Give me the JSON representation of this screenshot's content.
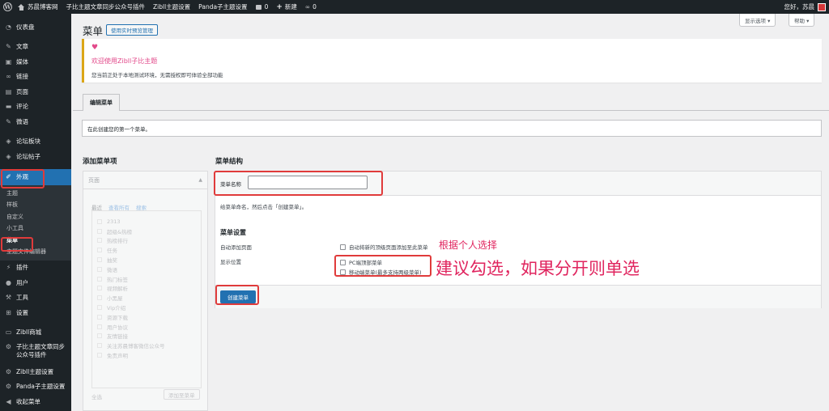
{
  "adminbar": {
    "site_name": "苏晨博客网",
    "items": [
      "子比主题文章同步公众号插件",
      "Zibll主题设置",
      "Panda子主题设置"
    ],
    "comments_count": "0",
    "new_label": "新建",
    "links_count": "0",
    "greeting": "您好，苏晨"
  },
  "screen_options_label": "显示选项 ▾",
  "help_label": "帮助 ▾",
  "sidebar": {
    "top": [
      {
        "icon": "dashboard-icon",
        "label": "仪表盘"
      }
    ],
    "group1": [
      {
        "icon": "pin-icon",
        "label": "文章"
      },
      {
        "icon": "media-icon",
        "label": "媒体"
      },
      {
        "icon": "link-icon",
        "label": "链接"
      },
      {
        "icon": "page-icon",
        "label": "页面"
      },
      {
        "icon": "comment-icon",
        "label": "评论"
      },
      {
        "icon": "pin-icon",
        "label": "微语"
      }
    ],
    "group2": [
      {
        "icon": "forum-icon",
        "label": "论坛板块"
      },
      {
        "icon": "forum-icon",
        "label": "论坛帖子"
      }
    ],
    "appearance": {
      "icon": "brush-icon",
      "label": "外观"
    },
    "appearance_sub": [
      "主题",
      "样板",
      "自定义",
      "小工具",
      "菜单",
      "主题文件编辑器"
    ],
    "appearance_current": "菜单",
    "group3": [
      {
        "icon": "plugin-icon",
        "label": "插件"
      },
      {
        "icon": "user-icon",
        "label": "用户"
      },
      {
        "icon": "wrench-icon",
        "label": "工具"
      },
      {
        "icon": "settings-icon",
        "label": "设置"
      }
    ],
    "group4": [
      {
        "icon": "shop-icon",
        "label": "Zibll商城"
      },
      {
        "icon": "gear-icon",
        "label": "子比主题文章同步公众号插件"
      },
      {
        "icon": "gear-icon",
        "label": "Zibll主题设置"
      },
      {
        "icon": "gear-icon",
        "label": "Panda子主题设置"
      },
      {
        "icon": "collapse-icon",
        "label": "收起菜单"
      }
    ]
  },
  "page": {
    "title": "菜单",
    "preview_button": "使用实时预览管理"
  },
  "notice": {
    "heading": "欢迎使用Zibll子比主题",
    "text": "您当前正处于本地测试环境，无需授权即可体验全部功能"
  },
  "tabs": {
    "edit_menus": "编辑菜单"
  },
  "info_text": "在此创建您的第一个菜单。",
  "add_items": {
    "heading": "添加菜单项",
    "section_title": "页面",
    "sub_tabs": [
      "最近",
      "查看所有",
      "搜索"
    ],
    "items": [
      "2313",
      "超级&热榜",
      "热榜排行",
      "任务",
      "抽奖",
      "微语",
      "热门标签",
      "视频解析",
      "小黑屋",
      "Vip介绍",
      "资源下载",
      "用户协议",
      "友情链接",
      "关注苏晨博客微信公众号",
      "免责声明"
    ],
    "select_all": "全选",
    "add_button": "添加至菜单"
  },
  "structure": {
    "heading": "菜单结构",
    "name_label": "菜单名称",
    "name_value": "",
    "help_text": "给菜单命名，然后点击「创建菜单」。",
    "settings_heading": "菜单设置",
    "auto_add_label": "自动添加页面",
    "auto_add_option": "自动将新的顶级页面添加至此菜单",
    "location_label": "显示位置",
    "locations": [
      "PC端顶部菜单",
      "移动端菜单(最多支持两级菜单)"
    ],
    "create_button": "创建菜单"
  },
  "annotations": {
    "note1": "根据个人选择",
    "note2": "建议勾选，如果分开则单选"
  },
  "colors": {
    "accent": "#2271b1",
    "annotation": "#e0245e",
    "highlight_box": "#e03b3b",
    "notice_border": "#dba617"
  }
}
